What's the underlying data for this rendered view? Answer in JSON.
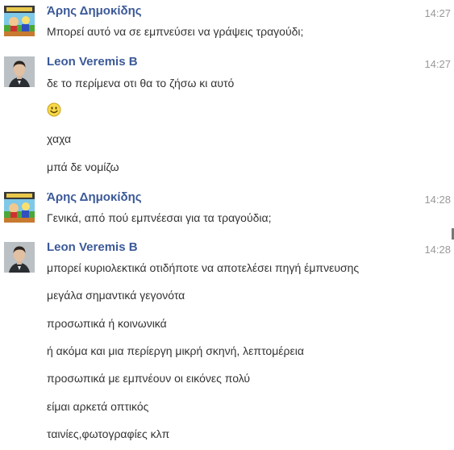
{
  "colors": {
    "sender_name": "#3b5998",
    "message_text": "#333333",
    "timestamp": "#999999"
  },
  "groups": [
    {
      "sender": "Άρης Δημοκίδης",
      "avatar": "cartoon-avatar",
      "time": "14:27",
      "messages": [
        "Μπορεί αυτό να σε εμπνεύσει να γράψεις τραγούδι;"
      ]
    },
    {
      "sender": "Leon Veremis B",
      "avatar": "profile-photo-avatar",
      "time": "14:27",
      "messages": [
        "δε το περίμενα οτι θα το ζήσω κι αυτό",
        "smile-emoji",
        "χαχα",
        "μπά δε νομίζω"
      ]
    },
    {
      "sender": "Άρης Δημοκίδης",
      "avatar": "cartoon-avatar",
      "time": "14:28",
      "messages": [
        "Γενικά, από πού εμπνέεσαι για τα τραγούδια;"
      ]
    },
    {
      "sender": "Leon Veremis B",
      "avatar": "profile-photo-avatar",
      "time": "14:28",
      "messages": [
        "μπορεί κυριολεκτικά οτιδήποτε να αποτελέσει πηγή έμπνευσης",
        "μεγάλα σημαντικά γεγονότα",
        "προσωπικά ή κοινωνικά",
        "ή ακόμα και μια περίεργη μικρή σκηνή, λεπτομέρεια",
        "προσωπικά με εμπνέουν οι εικόνες πολύ",
        "είμαι αρκετά οπτικός",
        "ταινίες,φωτογραφίες κλπ"
      ]
    }
  ]
}
